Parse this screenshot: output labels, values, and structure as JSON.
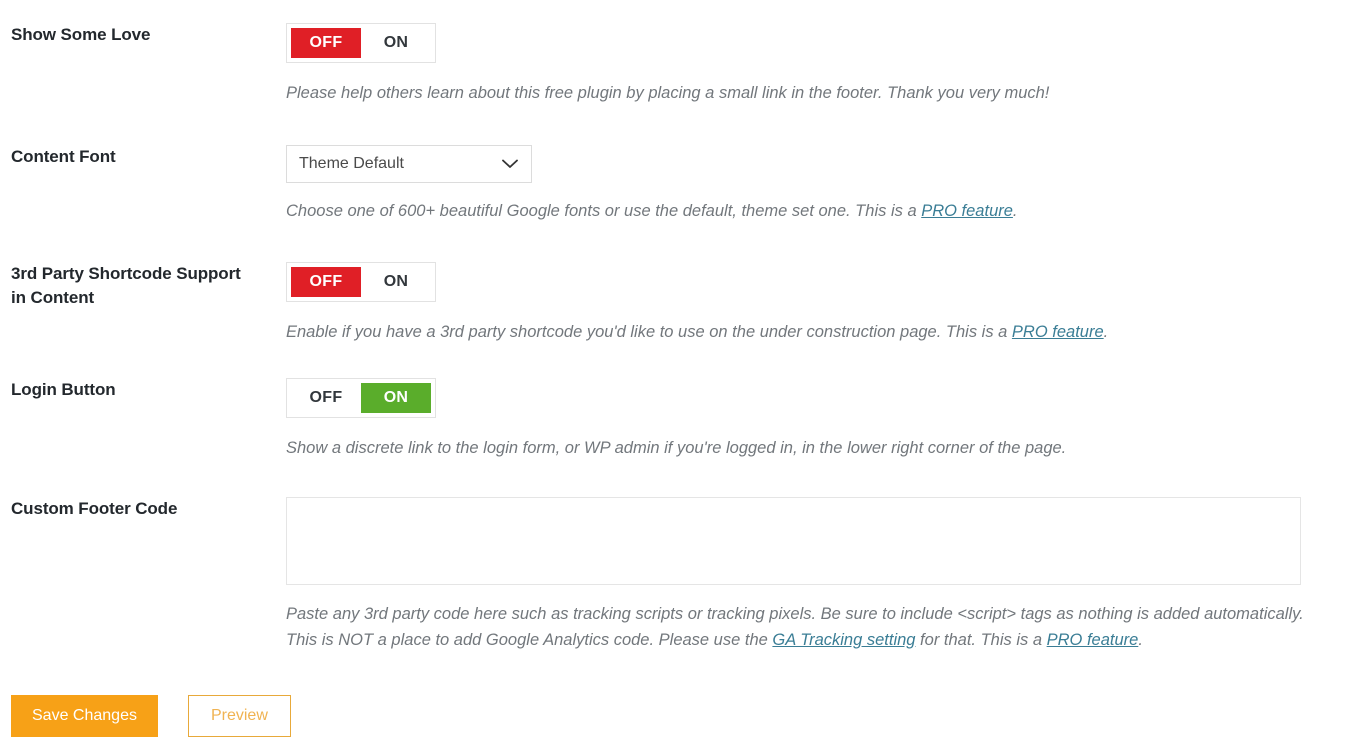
{
  "colors": {
    "toggle_off_red": "#e01f26",
    "toggle_on_green": "#5aad2b",
    "link": "#3a7d95",
    "save_button": "#f7a117",
    "preview_border": "#e8a93a",
    "label_text": "#23282d",
    "description_text": "#72777c"
  },
  "rows": {
    "show_some_love": {
      "label": "Show Some Love",
      "toggle": {
        "off_label": "OFF",
        "on_label": "ON",
        "state": "off"
      },
      "description": "Please help others learn about this free plugin by placing a small link in the footer. Thank you very much!"
    },
    "content_font": {
      "label": "Content Font",
      "select": {
        "value": "Theme Default",
        "icon": "chevron-down-icon"
      },
      "description_before": "Choose one of 600+ beautiful Google fonts or use the default, theme set one. This is a ",
      "description_link": "PRO feature",
      "description_after": "."
    },
    "shortcode_support": {
      "label": "3rd Party Shortcode Support in Content",
      "toggle": {
        "off_label": "OFF",
        "on_label": "ON",
        "state": "off"
      },
      "description_before": "Enable if you have a 3rd party shortcode you'd like to use on the under construction page. This is a ",
      "description_link": "PRO feature",
      "description_after": "."
    },
    "login_button": {
      "label": "Login Button",
      "toggle": {
        "off_label": "OFF",
        "on_label": "ON",
        "state": "on"
      },
      "description": "Show a discrete link to the login form, or WP admin if you're logged in, in the lower right corner of the page."
    },
    "custom_footer_code": {
      "label": "Custom Footer Code",
      "textarea": {
        "value": "",
        "placeholder": ""
      },
      "description_line1": "Paste any 3rd party code here such as tracking scripts or tracking pixels. Be sure to include <script> tags as nothing is added automatically.",
      "description_line2_before": "This is NOT a place to add Google Analytics code. Please use the ",
      "description_line2_link1": "GA Tracking setting",
      "description_line2_middle": " for that. This is a ",
      "description_line2_link2": "PRO feature",
      "description_line2_after": "."
    }
  },
  "footer_actions": {
    "save_label": "Save Changes",
    "preview_label": "Preview"
  }
}
